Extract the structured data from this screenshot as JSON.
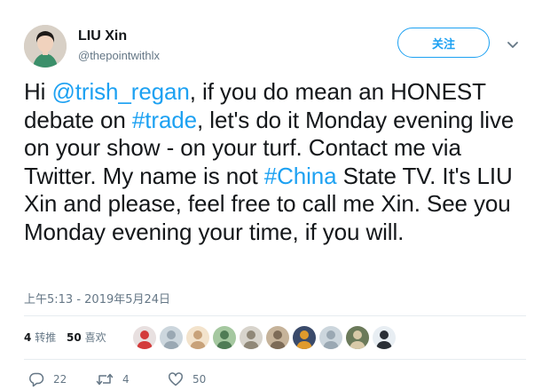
{
  "author": {
    "display_name": "LIU Xin",
    "handle": "@thepointwithlx"
  },
  "follow_label": "关注",
  "tweet": {
    "mention": "@trish_regan",
    "hashtag_trade": "#trade",
    "hashtag_china": "#China",
    "seg_hi": "Hi ",
    "seg_after_mention": ", if you do mean an HONEST debate on ",
    "seg_after_trade": ", let's do it Monday evening live on your show - on your turf. Contact me via Twitter.  My name is not ",
    "seg_after_china": " State TV. It's LIU Xin and please, feel free to call me Xin. See you Monday evening your time, if you will."
  },
  "timestamp": "上午5:13 - 2019年5月24日",
  "stats": {
    "retweets_count": "4",
    "retweets_label": "转推",
    "likes_count": "50",
    "likes_label": "喜欢"
  },
  "likers": [
    {
      "icon": "liker-1",
      "bg": "#e8e0e0",
      "fg": "#d33b3b"
    },
    {
      "icon": "liker-2",
      "bg": "#ccd6dd",
      "fg": "#9aa8b3"
    },
    {
      "icon": "liker-3",
      "bg": "#f3e3cc",
      "fg": "#c8a27a"
    },
    {
      "icon": "liker-4",
      "bg": "#a5c8a0",
      "fg": "#4f7c55"
    },
    {
      "icon": "liker-5",
      "bg": "#d8d4cc",
      "fg": "#908878"
    },
    {
      "icon": "liker-6",
      "bg": "#c6b39a",
      "fg": "#7d6b57"
    },
    {
      "icon": "liker-7",
      "bg": "#3a4a6a",
      "fg": "#e09a2c"
    },
    {
      "icon": "liker-8",
      "bg": "#ccd6dd",
      "fg": "#9aa8b3"
    },
    {
      "icon": "liker-9",
      "bg": "#6b7a5a",
      "fg": "#d8c9a8"
    },
    {
      "icon": "liker-10",
      "bg": "#e8eef3",
      "fg": "#2a2f36"
    }
  ],
  "actions": {
    "replies_count": "22",
    "retweets_count": "4",
    "likes_count": "50"
  },
  "colors": {
    "link_blue": "#1da1f2",
    "secondary_text": "#657786",
    "primary_text": "#14171a",
    "divider": "#e6ecf0"
  }
}
